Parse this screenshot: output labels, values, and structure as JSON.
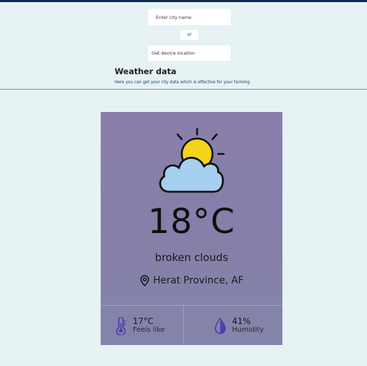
{
  "search": {
    "placeholder": "Enter city name",
    "or_label": "or",
    "device_button": "Get device location"
  },
  "section": {
    "title": "Weather data",
    "subtitle": "Here you can get your city data which is effective for your farming"
  },
  "weather": {
    "icon": "sun-behind-cloud-icon",
    "temperature": "18°C",
    "description": "broken clouds",
    "location": "Herat Province, AF",
    "feels_like_value": "17°C",
    "feels_like_label": "Feels like",
    "humidity_value": "41%",
    "humidity_label": "Humidity"
  },
  "colors": {
    "topbar": "#0e2a52",
    "page_bg": "#e6f2f4",
    "card_bg": "#8a7fab",
    "stat_icon": "#4f3fb0"
  }
}
